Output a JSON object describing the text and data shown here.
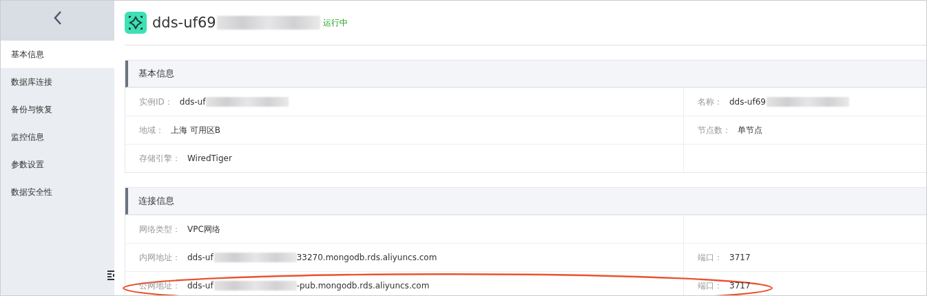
{
  "sidebar": {
    "items": [
      {
        "label": "基本信息",
        "selected": true
      },
      {
        "label": "数据库连接",
        "selected": false
      },
      {
        "label": "备份与恢复",
        "selected": false
      },
      {
        "label": "监控信息",
        "selected": false
      },
      {
        "label": "参数设置",
        "selected": false
      },
      {
        "label": "数据安全性",
        "selected": false
      }
    ]
  },
  "header": {
    "title": "dds-uf69",
    "title_redacted": true,
    "status": "运行中"
  },
  "sections": [
    {
      "title": "基本信息",
      "rows": [
        {
          "highlighted": false,
          "cells": [
            {
              "label": "实例ID：",
              "value": "dds-uf",
              "redacted": true
            },
            {
              "label": "名称：",
              "value": "dds-uf69",
              "redacted": true
            }
          ]
        },
        {
          "highlighted": false,
          "cells": [
            {
              "label": "地域：",
              "value": "上海 可用区B"
            },
            {
              "label": "节点数：",
              "value": "单节点"
            }
          ]
        },
        {
          "highlighted": false,
          "cells": [
            {
              "label": "存储引擎：",
              "value": "WiredTiger"
            }
          ]
        }
      ]
    },
    {
      "title": "连接信息",
      "rows": [
        {
          "highlighted": false,
          "cells": [
            {
              "label": "网络类型：",
              "value": "VPC网络"
            }
          ]
        },
        {
          "highlighted": false,
          "cells": [
            {
              "label": "内网地址：",
              "value": "dds-uf",
              "redacted": true,
              "value_suffix": "33270.mongodb.rds.aliyuncs.com"
            },
            {
              "label": "端口：",
              "value": "3717"
            }
          ]
        },
        {
          "highlighted": true,
          "cells": [
            {
              "label": "公网地址：",
              "value": "dds-uf",
              "redacted": true,
              "value_suffix": "-pub.mongodb.rds.aliyuncs.com"
            },
            {
              "label": "端口：",
              "value": "3717"
            }
          ]
        }
      ]
    }
  ]
}
